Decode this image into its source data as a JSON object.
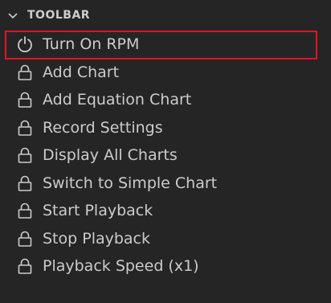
{
  "section": {
    "title": "TOOLBAR",
    "chevron_icon": "chevron-down-icon",
    "expanded": true
  },
  "items": [
    {
      "label": "Turn On RPM",
      "icon": "power-icon",
      "highlighted": true
    },
    {
      "label": "Add Chart",
      "icon": "lock-icon"
    },
    {
      "label": "Add Equation Chart",
      "icon": "lock-icon"
    },
    {
      "label": "Record Settings",
      "icon": "lock-icon"
    },
    {
      "label": "Display All Charts",
      "icon": "lock-icon"
    },
    {
      "label": "Switch to Simple Chart",
      "icon": "lock-icon"
    },
    {
      "label": "Start Playback",
      "icon": "lock-icon"
    },
    {
      "label": "Stop Playback",
      "icon": "lock-icon"
    },
    {
      "label": "Playback Speed (x1)",
      "icon": "lock-icon"
    }
  ],
  "colors": {
    "background": "#252526",
    "text": "#cccccc",
    "highlight_border": "#e81123"
  }
}
